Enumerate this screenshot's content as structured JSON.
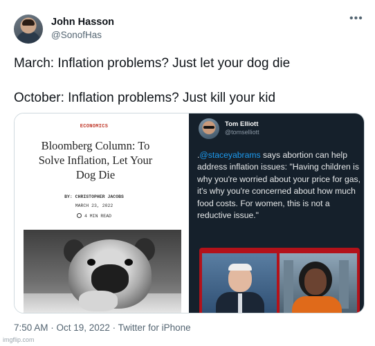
{
  "tweet": {
    "author_name": "John Hasson",
    "author_handle": "@SonofHas",
    "text_line1": "March: Inflation problems? Just let your dog die",
    "text_line2": "October: Inflation problems? Just kill your kid",
    "timestamp": "7:50 AM · Oct 19, 2022 · Twitter for iPhone",
    "more_icon": "more-horizontal-icon"
  },
  "article": {
    "section": "ECONOMICS",
    "title": "Bloomberg Column: To Solve Inflation, Let Your Dog Die",
    "byline": "BY: CHRISTOPHER JACOBS",
    "date": "MARCH 23, 2022",
    "read_time": "4 MIN READ",
    "image_icon": "pug-photo"
  },
  "embedded_tweet": {
    "author_name": "Tom Elliott",
    "author_handle": "@tomselliott",
    "text_prefix": ".",
    "mention": "@staceyabrams",
    "text_body": " says abortion can help address inflation issues: \"Having children is why you're worried about your price for gas, it's why you're concerned about how much food costs. For women, this is not a reductive issue.\"",
    "video_icon": "video-thumbnail"
  },
  "watermark": "imgflip.com",
  "colors": {
    "text_primary": "#0f1419",
    "text_secondary": "#536471",
    "dark_bg": "#15202b",
    "link_blue": "#1d9bf0",
    "section_red": "#c0392b",
    "video_red": "#b3121a"
  }
}
